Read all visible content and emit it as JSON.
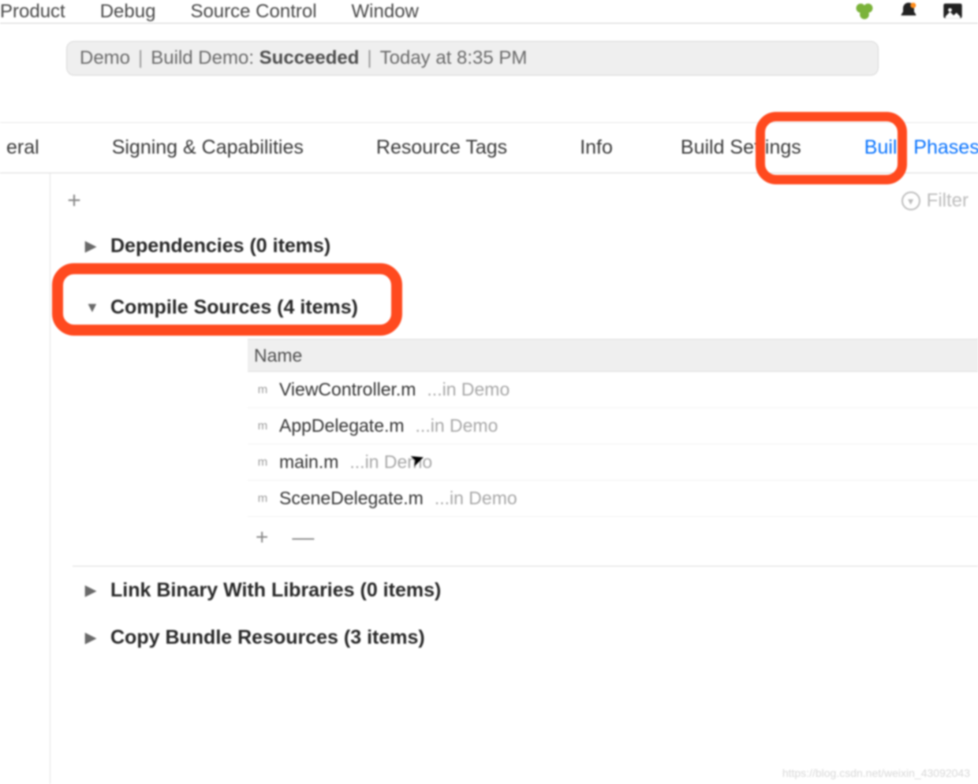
{
  "menubar": {
    "items": [
      "Product",
      "Debug",
      "Source Control",
      "Window"
    ]
  },
  "status": {
    "project": "Demo",
    "build_label": "Build Demo:",
    "result": "Succeeded",
    "when": "Today at 8:35 PM"
  },
  "tabs": {
    "general": "eral",
    "signing": "Signing & Capabilities",
    "resource": "Resource Tags",
    "info": "Info",
    "settings": "Build Settings",
    "phases": "Build Phases",
    "trail": "B"
  },
  "toolbar": {
    "plus": "+",
    "filter_placeholder": "Filter"
  },
  "phases": {
    "dependencies": "Dependencies (0 items)",
    "compile_sources": "Compile Sources (4 items)",
    "link_binary": "Link Binary With Libraries (0 items)",
    "copy_bundle": "Copy Bundle Resources (3 items)"
  },
  "table": {
    "header_name": "Name",
    "rows": [
      {
        "icon": "m",
        "file": "ViewController.m",
        "loc": "...in Demo"
      },
      {
        "icon": "m",
        "file": "AppDelegate.m",
        "loc": "...in Demo"
      },
      {
        "icon": "m",
        "file": "main.m",
        "loc": "...in Demo"
      },
      {
        "icon": "m",
        "file": "SceneDelegate.m",
        "loc": "...in Demo"
      }
    ],
    "add": "+",
    "remove": "—"
  },
  "watermark": "https://blog.csdn.net/weixin_43092043",
  "colors": {
    "highlight": "#ff4a1f",
    "tab_active": "#0a74ff"
  },
  "icons": {
    "clover": "clover-icon",
    "bell": "bell-icon",
    "picture": "picture-icon",
    "filter": "filter-icon",
    "m_file": "m-file-icon"
  }
}
